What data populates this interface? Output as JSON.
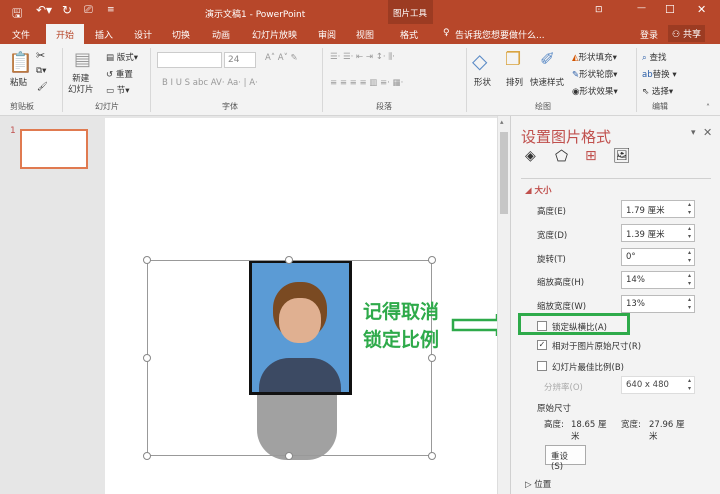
{
  "titlebar": {
    "title": "演示文稿1 - PowerPoint",
    "context_tool": "图片工具"
  },
  "tabs": [
    "文件",
    "开始",
    "插入",
    "设计",
    "切换",
    "动画",
    "幻灯片放映",
    "审阅",
    "视图",
    "格式"
  ],
  "tell_me": "告诉我您想要做什么...",
  "login": "登录",
  "share": "共享",
  "ribbon": {
    "paste": "粘贴",
    "new_slide": "新建\n幻灯片",
    "layout": "版式",
    "reset": "重置",
    "section": "节",
    "font_size": "24",
    "shape": "形状",
    "arrange": "排列",
    "quick_styles": "快速样式",
    "shape_fill": "形状填充",
    "shape_outline": "形状轮廓",
    "shape_effects": "形状效果",
    "find": "查找",
    "replace": "替换",
    "select": "选择",
    "groups": [
      "剪贴板",
      "幻灯片",
      "字体",
      "段落",
      "绘图",
      "编辑"
    ]
  },
  "thumb_number": "1",
  "annotation": {
    "line1": "记得取消",
    "line2": "锁定比例",
    "color": "#2eaa4a"
  },
  "pane": {
    "title": "设置图片格式",
    "section": "大小",
    "fields": [
      {
        "label": "高度(E)",
        "value": "1.79 厘米"
      },
      {
        "label": "宽度(D)",
        "value": "1.39 厘米"
      },
      {
        "label": "旋转(T)",
        "value": "0°"
      },
      {
        "label": "缩放高度(H)",
        "value": "14%"
      },
      {
        "label": "缩放宽度(W)",
        "value": "13%"
      }
    ],
    "lock": {
      "label": "锁定纵横比(A)",
      "checked": false
    },
    "relative": {
      "label": "相对于图片原始尺寸(R)",
      "checked": true
    },
    "best": {
      "label": "幻灯片最佳比例(B)",
      "checked": false
    },
    "resolution_label": "分辨率(O)",
    "resolution": "640 x 480",
    "original": "原始尺寸",
    "orig_h_label": "高度:",
    "orig_h": "18.65 厘米",
    "orig_w_label": "宽度:",
    "orig_w": "27.96 厘米",
    "reset": "重设(S)",
    "position": "位置"
  }
}
